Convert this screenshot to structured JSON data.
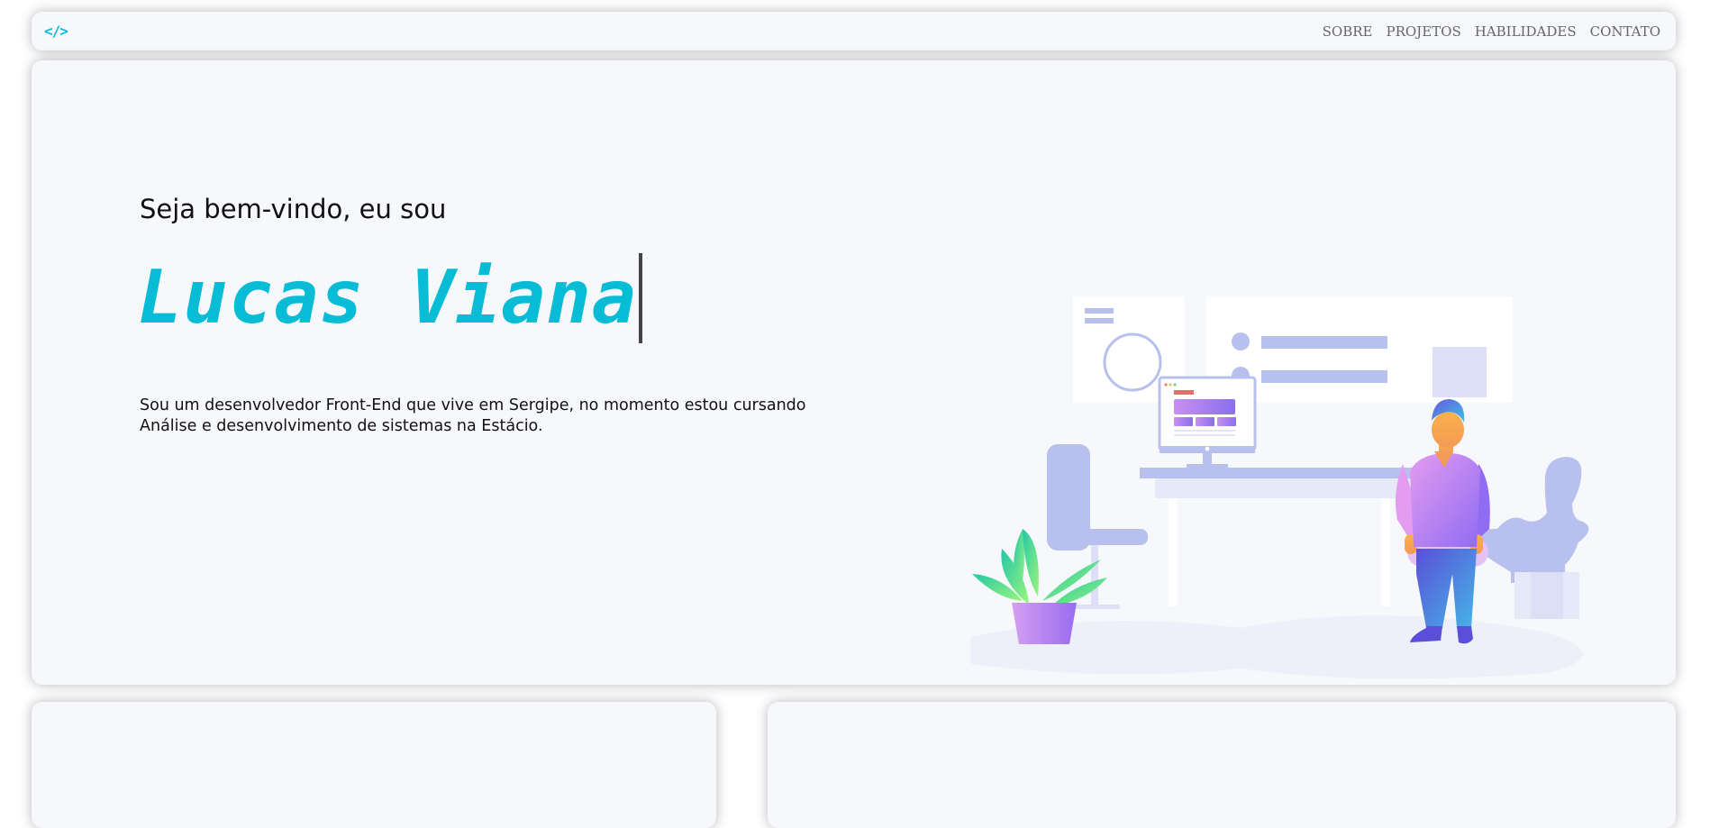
{
  "navbar": {
    "logo": "</>",
    "links": [
      "SOBRE",
      "PROJETOS",
      "HABILIDADES",
      "CONTATO"
    ]
  },
  "hero": {
    "greeting": "Seja bem-vindo, eu sou",
    "name": "Lucas Viana",
    "bio": "Sou um desenvolvedor Front-End que vive em Sergipe, no momento estou cursando Análise e desenvolvimento de sistemas na Estácio."
  },
  "colors": {
    "accent": "#08bcd6",
    "card_bg": "#f7f8fc",
    "illustration_lavender": "#b8c0ee"
  }
}
